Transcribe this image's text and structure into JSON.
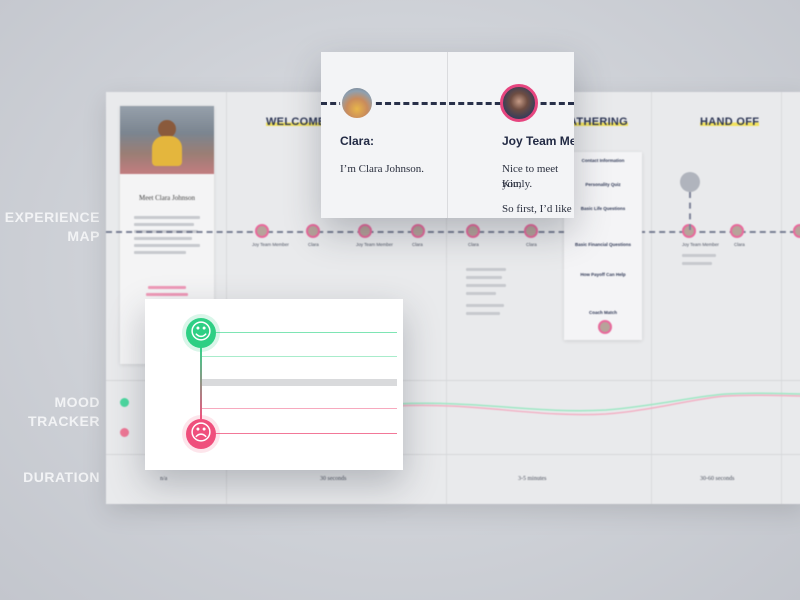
{
  "side_labels": {
    "experience_map": "EXPERIENCE\nMAP",
    "mood_tracker": "MOOD\nTRACKER",
    "duration": "DURATION"
  },
  "stages": [
    {
      "title": "WELCOME & I"
    },
    {
      "title": "ATHERING"
    },
    {
      "title": "HAND OFF"
    }
  ],
  "profile": {
    "name": "Meet Clara Johnson"
  },
  "timeline_captions": [
    "Joy Team Member",
    "Clara",
    "Joy Team Member",
    "Clara",
    "Clara",
    "Joy Team Member",
    "Clara",
    "Joy Team Member",
    "Clara"
  ],
  "info_card": {
    "sections": [
      "Contact Information",
      "Personality Quiz",
      "Basic Life Questions",
      "Basic Financial Questions",
      "How Payoff Can Help",
      "Coach Match"
    ]
  },
  "durations": [
    "n/a",
    "30 seconds",
    "3-5 minutes",
    "30-60 seconds"
  ],
  "conversation": {
    "left": {
      "speaker": "Clara:",
      "text": "I’m Clara Johnson."
    },
    "right": {
      "speaker": "Joy Team Mem",
      "text1": "Nice to meet you,",
      "text2": "Kimly.",
      "text3": "So first, I’d like to"
    }
  },
  "mood_zoom": {
    "happy_icon": "happy-face-icon",
    "sad_icon": "sad-face-icon",
    "colors": {
      "happy": "#2ecf84",
      "sad": "#ef4f7c",
      "accent": "#e6457f",
      "highlight": "#f2e25c"
    }
  }
}
